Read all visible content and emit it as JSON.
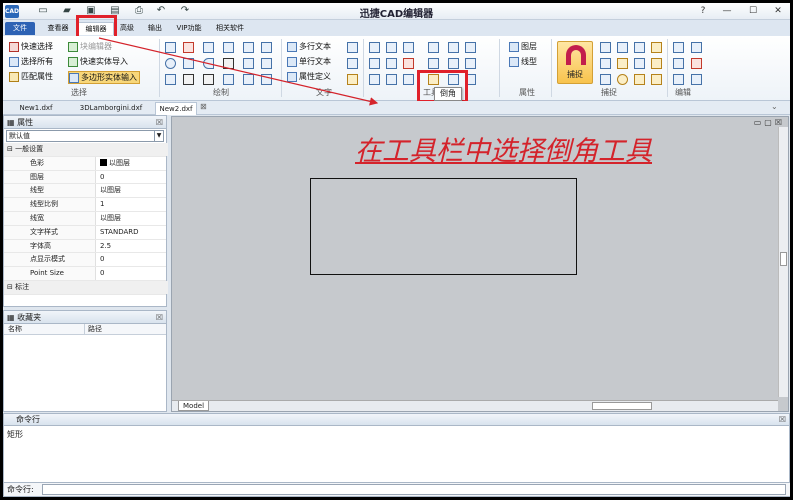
{
  "window": {
    "title": "迅捷CAD编辑器",
    "app_icon": "CAD"
  },
  "menu": {
    "items": [
      "文件",
      "查看器",
      "编辑器",
      "高级",
      "输出",
      "VIP功能",
      "相关软件"
    ],
    "active": "编辑器"
  },
  "ribbon": {
    "select": {
      "quick_select": "快速选择",
      "select_all": "选择所有",
      "match_props": "匹配属性",
      "block_edit": "块编辑器",
      "quick_import": "快速实体导入",
      "polygon_input": "多边形实体输入",
      "group": "选择"
    },
    "draw": {
      "group": "绘制"
    },
    "text": {
      "multiline": "多行文本",
      "singleline": "单行文本",
      "attr_def": "属性定义",
      "group": "文字"
    },
    "tools": {
      "group": "工具"
    },
    "props": {
      "layers": "图层",
      "linetype": "线型",
      "group": "属性"
    },
    "snap": {
      "label": "捕捉",
      "group": "捕捉"
    },
    "edit": {
      "group": "编辑"
    }
  },
  "tooltip": {
    "text": "倒角"
  },
  "tabs": [
    {
      "label": "New1.dxf"
    },
    {
      "label": "3DLamborgini.dxf"
    },
    {
      "label": "New2.dxf"
    }
  ],
  "properties": {
    "title": "属性",
    "selector": "默认值",
    "category_general": "一般设置",
    "rows": [
      {
        "k": "色彩",
        "v": "以图层"
      },
      {
        "k": "图层",
        "v": "0"
      },
      {
        "k": "线型",
        "v": "以图层"
      },
      {
        "k": "线型比例",
        "v": "1"
      },
      {
        "k": "线宽",
        "v": "以图层"
      },
      {
        "k": "文字样式",
        "v": "STANDARD"
      },
      {
        "k": "字体高",
        "v": "2.5"
      },
      {
        "k": "点显示模式",
        "v": "0"
      },
      {
        "k": "Point Size",
        "v": "0"
      }
    ],
    "category_dim": "标注"
  },
  "favorites": {
    "title": "收藏夹",
    "col_name": "名称",
    "col_path": "路径"
  },
  "drawing": {
    "annotation": "在工具栏中选择倒角工具",
    "model_tab": "Model"
  },
  "command": {
    "title": "命令行",
    "output": "矩形",
    "prompt": "命令行:"
  },
  "colors": {
    "highlight": "#e0202a",
    "annotation": "#d4232b",
    "file_menu": "#2d62b4"
  }
}
